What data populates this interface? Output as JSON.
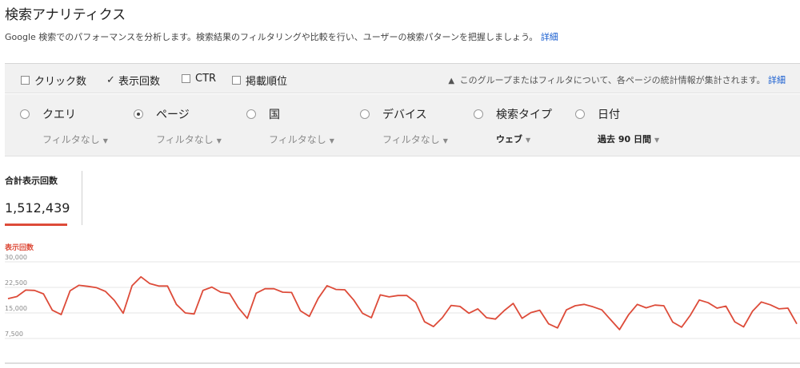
{
  "header": {
    "title": "検索アナリティクス",
    "description": "Google 検索でのパフォーマンスを分析します。検索結果のフィルタリングや比較を行い、ユーザーの検索パターンを把握しましょう。",
    "description_link": "詳細"
  },
  "metrics": [
    {
      "label": "クリック数",
      "checked": false
    },
    {
      "label": "表示回数",
      "checked": true
    },
    {
      "label": "CTR",
      "checked": false
    },
    {
      "label": "掲載順位",
      "checked": false
    }
  ],
  "metrics_note": {
    "text": "このグループまたはフィルタについて、各ページの統計情報が集計されます。",
    "link": "詳細"
  },
  "dimensions": [
    {
      "label": "クエリ",
      "filter": "フィルタなし",
      "selected": false
    },
    {
      "label": "ページ",
      "filter": "フィルタなし",
      "selected": true
    },
    {
      "label": "国",
      "filter": "フィルタなし",
      "selected": false
    },
    {
      "label": "デバイス",
      "filter": "フィルタなし",
      "selected": false
    },
    {
      "label": "検索タイプ",
      "filter": "ウェブ",
      "selected": false
    },
    {
      "label": "日付",
      "filter": "過去 90 日間",
      "selected": false
    }
  ],
  "summary": {
    "label": "合計表示回数",
    "value": "1,512,439"
  },
  "colors": {
    "accent": "#dd4b39",
    "link": "#1a5fd0"
  },
  "chart_data": {
    "type": "line",
    "series_label": "表示回数",
    "ylim": [
      0,
      30000
    ],
    "yticks": [
      {
        "value": 30000,
        "label": "30,000"
      },
      {
        "value": 22500,
        "label": "22,500"
      },
      {
        "value": 15000,
        "label": "15,000"
      },
      {
        "value": 7500,
        "label": "7,500"
      }
    ],
    "grid": true,
    "values": [
      19200,
      19800,
      21700,
      21600,
      20600,
      15800,
      14500,
      21500,
      23100,
      22800,
      22400,
      21300,
      18700,
      14900,
      23000,
      25600,
      23600,
      22900,
      22900,
      17500,
      15000,
      14700,
      21600,
      22600,
      21100,
      20700,
      16500,
      13400,
      20800,
      22100,
      22100,
      21100,
      21000,
      15600,
      14000,
      19300,
      23000,
      21900,
      21800,
      18800,
      14900,
      13600,
      20300,
      19700,
      20100,
      20100,
      18100,
      12400,
      11000,
      13600,
      17200,
      16900,
      14900,
      16200,
      13600,
      13200,
      15700,
      17800,
      13400,
      15100,
      15800,
      11800,
      10600,
      15900,
      17100,
      17500,
      16800,
      15900,
      13000,
      10100,
      14400,
      17500,
      16500,
      17300,
      17100,
      12300,
      10800,
      14400,
      18800,
      18000,
      16400,
      17000,
      12400,
      10900,
      15500,
      18200,
      17400,
      16200,
      16400,
      11800
    ]
  }
}
